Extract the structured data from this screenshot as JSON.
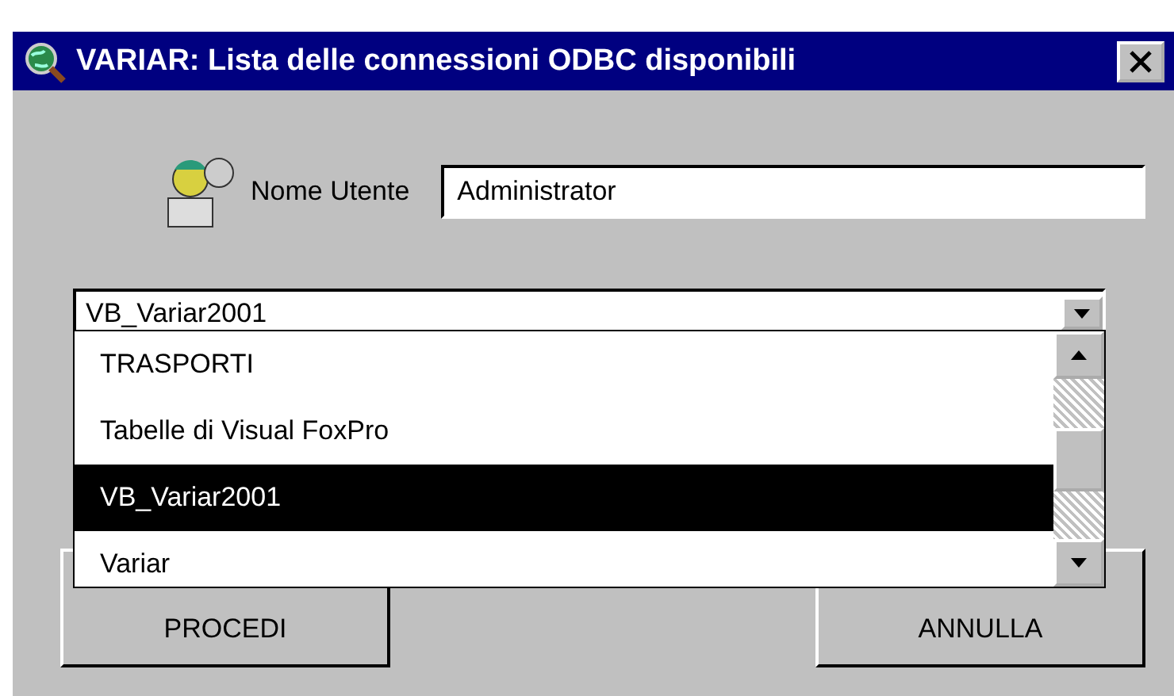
{
  "window": {
    "title": "VARIAR: Lista delle connessioni ODBC disponibili"
  },
  "user": {
    "label": "Nome Utente",
    "value": "Administrator"
  },
  "combo": {
    "value": "VB_Variar2001",
    "expanded": true,
    "options": [
      {
        "label": "TRASPORTI",
        "selected": false
      },
      {
        "label": "Tabelle di Visual FoxPro",
        "selected": false
      },
      {
        "label": "VB_Variar2001",
        "selected": true
      },
      {
        "label": "Variar",
        "selected": false
      }
    ]
  },
  "buttons": [
    "PROCEDI",
    "ANNULLA"
  ]
}
